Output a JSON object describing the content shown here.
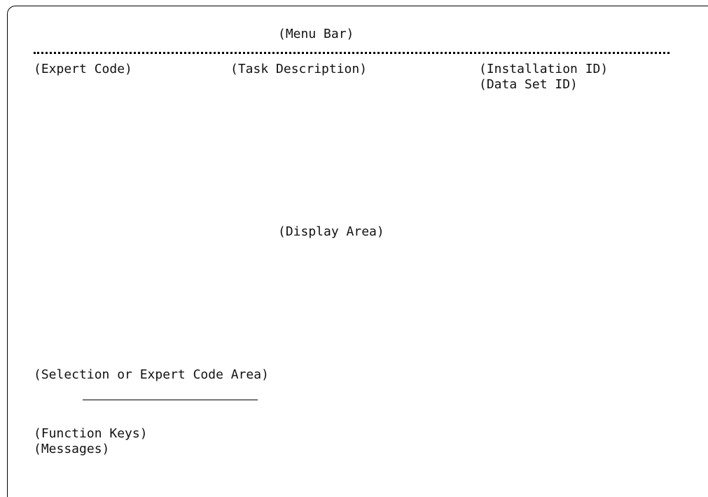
{
  "screen": {
    "menu_bar": "(Menu Bar)",
    "expert_code": "(Expert Code)",
    "task_description": "(Task Description)",
    "installation_id": "(Installation ID)",
    "data_set_id": "(Data Set ID)",
    "display_area": "(Display Area)",
    "selection_area": "(Selection or Expert Code Area)",
    "function_keys": "(Function Keys)",
    "messages": "(Messages)"
  }
}
